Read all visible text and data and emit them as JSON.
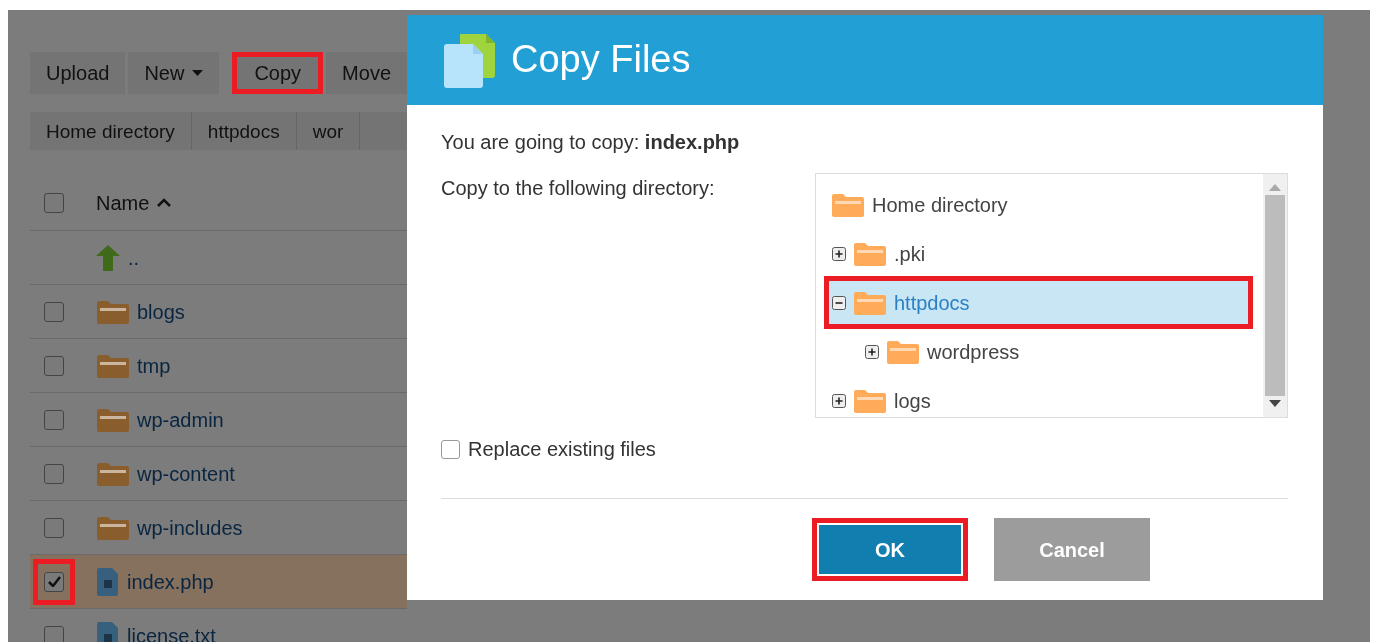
{
  "toolbar": [
    {
      "label": "Upload",
      "kind": "button",
      "annotated": false
    },
    {
      "label": "New",
      "kind": "dropdown",
      "annotated": false
    },
    {
      "label": "Copy",
      "kind": "button",
      "annotated": true
    },
    {
      "label": "Move",
      "kind": "button",
      "annotated": false
    }
  ],
  "breadcrumbs": [
    "Home directory",
    "httpdocs",
    "wor"
  ],
  "table": {
    "select_all": {
      "checked": false
    },
    "columns": [
      {
        "label": "Name",
        "sorted": true
      }
    ],
    "rows": [
      {
        "name": "..",
        "kind": "up",
        "selected": false
      },
      {
        "name": "blogs",
        "kind": "folder",
        "checked": false,
        "selected": false,
        "annotated": false
      },
      {
        "name": "tmp",
        "kind": "folder",
        "checked": false,
        "selected": false,
        "annotated": false
      },
      {
        "name": "wp-admin",
        "kind": "folder",
        "checked": false,
        "selected": false,
        "annotated": false
      },
      {
        "name": "wp-content",
        "kind": "folder",
        "checked": false,
        "selected": false,
        "annotated": false
      },
      {
        "name": "wp-includes",
        "kind": "folder",
        "checked": false,
        "selected": false,
        "annotated": false
      },
      {
        "name": "index.php",
        "kind": "file",
        "checked": true,
        "selected": true,
        "annotated": true
      },
      {
        "name": "license.txt",
        "kind": "file",
        "checked": false,
        "selected": false,
        "annotated": false
      }
    ]
  },
  "dialog": {
    "title": "Copy Files",
    "message": "You are going to copy: **index.php**",
    "target_label": "Copy to the following directory:",
    "tree": [
      {
        "label": "Home directory",
        "selected": false,
        "annotated": false,
        "children": [
          {
            "label": ".pki",
            "expanded": false,
            "selected": false,
            "annotated": false
          },
          {
            "label": "httpdocs",
            "expanded": true,
            "selected": true,
            "annotated": true,
            "children": [
              {
                "label": "wordpress",
                "expanded": false,
                "selected": false,
                "annotated": false
              }
            ]
          },
          {
            "label": "logs",
            "expanded": false,
            "selected": false,
            "annotated": false
          }
        ]
      }
    ],
    "replace": {
      "label": "Replace existing files",
      "checked": false
    },
    "buttons": [
      {
        "label": "OK",
        "kind": "primary",
        "annotated": true
      },
      {
        "label": "Cancel",
        "kind": "secondary",
        "annotated": false
      }
    ]
  }
}
